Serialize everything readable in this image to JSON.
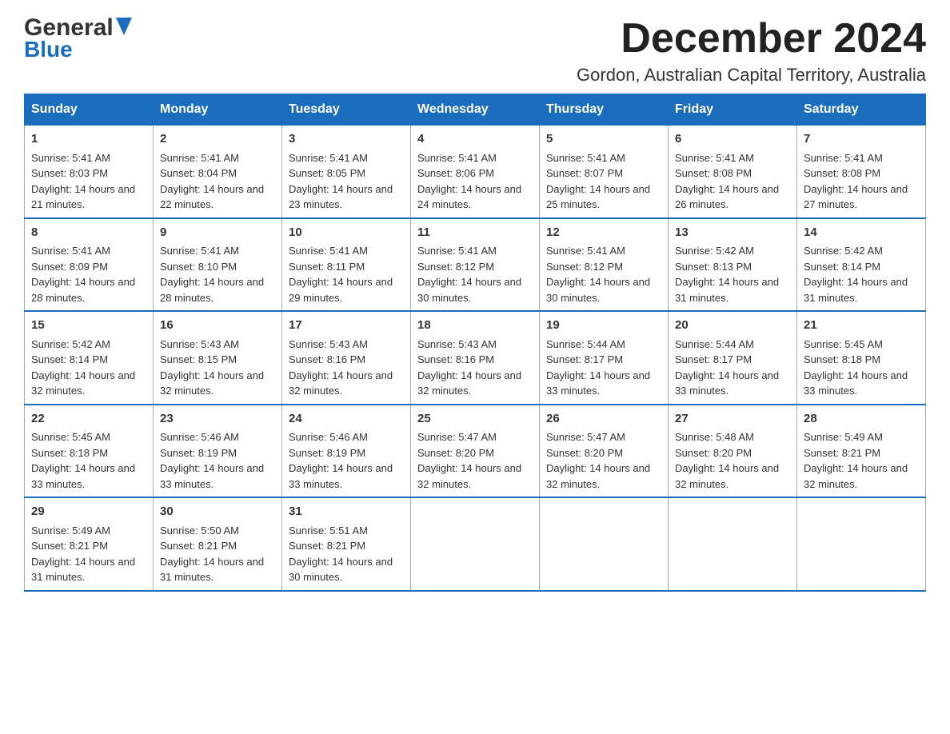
{
  "logo": {
    "general": "General",
    "blue": "Blue",
    "triangle_char": "▶"
  },
  "title": {
    "month_year": "December 2024",
    "location": "Gordon, Australian Capital Territory, Australia"
  },
  "days_of_week": [
    "Sunday",
    "Monday",
    "Tuesday",
    "Wednesday",
    "Thursday",
    "Friday",
    "Saturday"
  ],
  "weeks": [
    [
      {
        "day": "1",
        "sunrise": "Sunrise: 5:41 AM",
        "sunset": "Sunset: 8:03 PM",
        "daylight": "Daylight: 14 hours and 21 minutes."
      },
      {
        "day": "2",
        "sunrise": "Sunrise: 5:41 AM",
        "sunset": "Sunset: 8:04 PM",
        "daylight": "Daylight: 14 hours and 22 minutes."
      },
      {
        "day": "3",
        "sunrise": "Sunrise: 5:41 AM",
        "sunset": "Sunset: 8:05 PM",
        "daylight": "Daylight: 14 hours and 23 minutes."
      },
      {
        "day": "4",
        "sunrise": "Sunrise: 5:41 AM",
        "sunset": "Sunset: 8:06 PM",
        "daylight": "Daylight: 14 hours and 24 minutes."
      },
      {
        "day": "5",
        "sunrise": "Sunrise: 5:41 AM",
        "sunset": "Sunset: 8:07 PM",
        "daylight": "Daylight: 14 hours and 25 minutes."
      },
      {
        "day": "6",
        "sunrise": "Sunrise: 5:41 AM",
        "sunset": "Sunset: 8:08 PM",
        "daylight": "Daylight: 14 hours and 26 minutes."
      },
      {
        "day": "7",
        "sunrise": "Sunrise: 5:41 AM",
        "sunset": "Sunset: 8:08 PM",
        "daylight": "Daylight: 14 hours and 27 minutes."
      }
    ],
    [
      {
        "day": "8",
        "sunrise": "Sunrise: 5:41 AM",
        "sunset": "Sunset: 8:09 PM",
        "daylight": "Daylight: 14 hours and 28 minutes."
      },
      {
        "day": "9",
        "sunrise": "Sunrise: 5:41 AM",
        "sunset": "Sunset: 8:10 PM",
        "daylight": "Daylight: 14 hours and 28 minutes."
      },
      {
        "day": "10",
        "sunrise": "Sunrise: 5:41 AM",
        "sunset": "Sunset: 8:11 PM",
        "daylight": "Daylight: 14 hours and 29 minutes."
      },
      {
        "day": "11",
        "sunrise": "Sunrise: 5:41 AM",
        "sunset": "Sunset: 8:12 PM",
        "daylight": "Daylight: 14 hours and 30 minutes."
      },
      {
        "day": "12",
        "sunrise": "Sunrise: 5:41 AM",
        "sunset": "Sunset: 8:12 PM",
        "daylight": "Daylight: 14 hours and 30 minutes."
      },
      {
        "day": "13",
        "sunrise": "Sunrise: 5:42 AM",
        "sunset": "Sunset: 8:13 PM",
        "daylight": "Daylight: 14 hours and 31 minutes."
      },
      {
        "day": "14",
        "sunrise": "Sunrise: 5:42 AM",
        "sunset": "Sunset: 8:14 PM",
        "daylight": "Daylight: 14 hours and 31 minutes."
      }
    ],
    [
      {
        "day": "15",
        "sunrise": "Sunrise: 5:42 AM",
        "sunset": "Sunset: 8:14 PM",
        "daylight": "Daylight: 14 hours and 32 minutes."
      },
      {
        "day": "16",
        "sunrise": "Sunrise: 5:43 AM",
        "sunset": "Sunset: 8:15 PM",
        "daylight": "Daylight: 14 hours and 32 minutes."
      },
      {
        "day": "17",
        "sunrise": "Sunrise: 5:43 AM",
        "sunset": "Sunset: 8:16 PM",
        "daylight": "Daylight: 14 hours and 32 minutes."
      },
      {
        "day": "18",
        "sunrise": "Sunrise: 5:43 AM",
        "sunset": "Sunset: 8:16 PM",
        "daylight": "Daylight: 14 hours and 32 minutes."
      },
      {
        "day": "19",
        "sunrise": "Sunrise: 5:44 AM",
        "sunset": "Sunset: 8:17 PM",
        "daylight": "Daylight: 14 hours and 33 minutes."
      },
      {
        "day": "20",
        "sunrise": "Sunrise: 5:44 AM",
        "sunset": "Sunset: 8:17 PM",
        "daylight": "Daylight: 14 hours and 33 minutes."
      },
      {
        "day": "21",
        "sunrise": "Sunrise: 5:45 AM",
        "sunset": "Sunset: 8:18 PM",
        "daylight": "Daylight: 14 hours and 33 minutes."
      }
    ],
    [
      {
        "day": "22",
        "sunrise": "Sunrise: 5:45 AM",
        "sunset": "Sunset: 8:18 PM",
        "daylight": "Daylight: 14 hours and 33 minutes."
      },
      {
        "day": "23",
        "sunrise": "Sunrise: 5:46 AM",
        "sunset": "Sunset: 8:19 PM",
        "daylight": "Daylight: 14 hours and 33 minutes."
      },
      {
        "day": "24",
        "sunrise": "Sunrise: 5:46 AM",
        "sunset": "Sunset: 8:19 PM",
        "daylight": "Daylight: 14 hours and 33 minutes."
      },
      {
        "day": "25",
        "sunrise": "Sunrise: 5:47 AM",
        "sunset": "Sunset: 8:20 PM",
        "daylight": "Daylight: 14 hours and 32 minutes."
      },
      {
        "day": "26",
        "sunrise": "Sunrise: 5:47 AM",
        "sunset": "Sunset: 8:20 PM",
        "daylight": "Daylight: 14 hours and 32 minutes."
      },
      {
        "day": "27",
        "sunrise": "Sunrise: 5:48 AM",
        "sunset": "Sunset: 8:20 PM",
        "daylight": "Daylight: 14 hours and 32 minutes."
      },
      {
        "day": "28",
        "sunrise": "Sunrise: 5:49 AM",
        "sunset": "Sunset: 8:21 PM",
        "daylight": "Daylight: 14 hours and 32 minutes."
      }
    ],
    [
      {
        "day": "29",
        "sunrise": "Sunrise: 5:49 AM",
        "sunset": "Sunset: 8:21 PM",
        "daylight": "Daylight: 14 hours and 31 minutes."
      },
      {
        "day": "30",
        "sunrise": "Sunrise: 5:50 AM",
        "sunset": "Sunset: 8:21 PM",
        "daylight": "Daylight: 14 hours and 31 minutes."
      },
      {
        "day": "31",
        "sunrise": "Sunrise: 5:51 AM",
        "sunset": "Sunset: 8:21 PM",
        "daylight": "Daylight: 14 hours and 30 minutes."
      },
      null,
      null,
      null,
      null
    ]
  ]
}
